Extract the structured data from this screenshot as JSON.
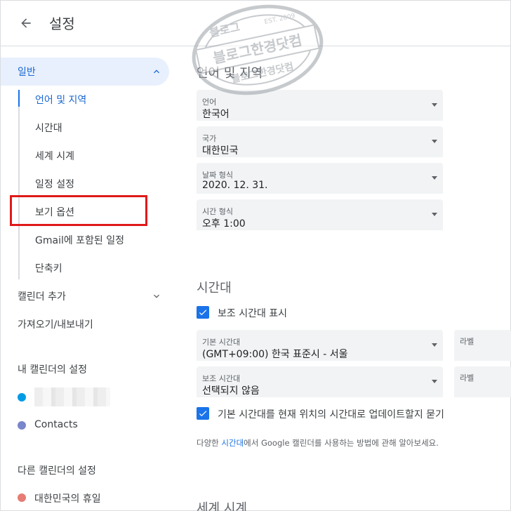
{
  "header": {
    "title": "설정"
  },
  "sidebar": {
    "general_label": "일반",
    "general_items": [
      "언어 및 지역",
      "시간대",
      "세계 시계",
      "일정 설정",
      "보기 옵션",
      "Gmail에 포함된 일정",
      "단축키"
    ],
    "add_calendar": "캘린더 추가",
    "import_export": "가져오기/내보내기",
    "my_calendars_heading": "내 캘린더의 설정",
    "my_calendars": [
      {
        "name": "",
        "color": "#039be5"
      },
      {
        "name": "Contacts",
        "color": "#7986cb"
      }
    ],
    "other_calendars_heading": "다른 캘린더의 설정",
    "other_calendars": [
      {
        "name": "대한민국의 휴일",
        "color": "#e67c73"
      }
    ]
  },
  "main": {
    "language_section": {
      "heading": "언어 및 지역",
      "fields": [
        {
          "label": "언어",
          "value": "한국어"
        },
        {
          "label": "국가",
          "value": "대한민국"
        },
        {
          "label": "날짜 형식",
          "value": "2020. 12. 31."
        },
        {
          "label": "시간 형식",
          "value": "오후 1:00"
        }
      ]
    },
    "timezone_section": {
      "heading": "시간대",
      "show_secondary": "보조 시간대 표시",
      "primary": {
        "label": "기본 시간대",
        "value": "(GMT+09:00) 한국 표준시 - 서울",
        "tag_label": "라벨"
      },
      "secondary": {
        "label": "보조 시간대",
        "value": "선택되지 않음",
        "tag_label": "라벨"
      },
      "ask_update": "기본 시간대를 현재 위치의 시간대로 업데이트할지 묻기",
      "help_before": "다양한 ",
      "help_link": "시간대",
      "help_after": "에서 Google 캘린더를 사용하는 방법에 관해 알아보세요."
    },
    "world_clock_section": {
      "heading": "세계 시계"
    }
  },
  "watermark": {
    "text_top": "블로그",
    "text_main": "블로그한경닷컴",
    "est": "EST. 2009"
  },
  "colors": {
    "accent": "#1a73e8",
    "active_bg": "#e8f0fe",
    "highlight_box": "#e01919"
  }
}
